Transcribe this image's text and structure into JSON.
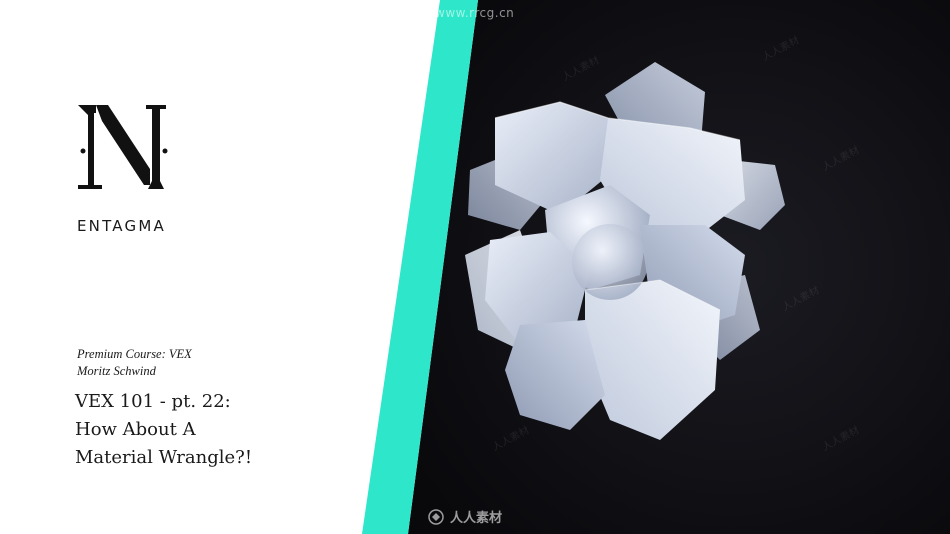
{
  "brand": {
    "name": "ENTAGMA",
    "logo_icon": "entagma-n-logo"
  },
  "course": {
    "label": "Premium Course: VEX",
    "author": "Moritz Schwind"
  },
  "title": {
    "lines": [
      "VEX 101 - pt. 22:",
      "How About A",
      "Material Wrangle?!"
    ]
  },
  "watermarks": {
    "top_url": "www.rrcg.cn",
    "bottom_text": "人人素材"
  },
  "colors": {
    "accent": "#2ee6c9",
    "dark_bg": "#0d0d10",
    "light_bg": "#ffffff"
  }
}
